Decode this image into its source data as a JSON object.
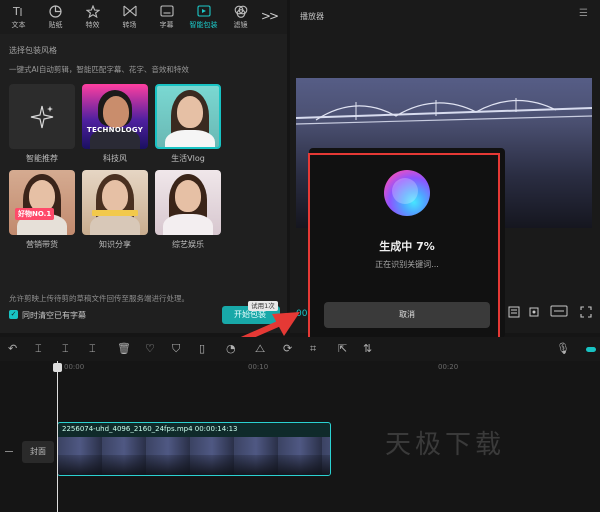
{
  "left_panel": {
    "tabs": [
      {
        "label": "文本",
        "icon": "text-icon"
      },
      {
        "label": "贴纸",
        "icon": "sticker-icon"
      },
      {
        "label": "特效",
        "icon": "effects-icon"
      },
      {
        "label": "转场",
        "icon": "transition-icon"
      },
      {
        "label": "字幕",
        "icon": "caption-icon"
      },
      {
        "label": "智能包装",
        "icon": "smart-pack-icon",
        "active": true
      },
      {
        "label": "滤镜",
        "icon": "filter-icon"
      }
    ],
    "more_label": ">>",
    "section_title": "选择包装风格",
    "section_desc": "一键式AI自动剪辑，智能匹配字幕、花字、音效和特效",
    "styles": [
      {
        "label": "智能推荐",
        "thumb_text": ""
      },
      {
        "label": "科技风",
        "thumb_text": "TECHNOLOGY"
      },
      {
        "label": "生活Vlog",
        "thumb_text": ""
      },
      {
        "label": "营销带货",
        "thumb_text": "好物NO.1"
      },
      {
        "label": "知识分享",
        "thumb_text": ""
      },
      {
        "label": "综艺娱乐",
        "thumb_text": ""
      }
    ],
    "notice": "允许剪映上传待剪的草稿文件回传至服务端进行处理。",
    "checkbox_label": "同时清空已有字幕",
    "start_button": "开始包装",
    "free_badge": "试用1次"
  },
  "player": {
    "title": "播放器",
    "time_left": "00:",
    "menu_icon": "hamburger-icon"
  },
  "dialog": {
    "status_title": "生成中 7%",
    "status_sub": "正在识别关键词...",
    "cancel_label": "取消",
    "progress_percent": 7,
    "highlight_color": "#e53935"
  },
  "timeline": {
    "ruler_labels": [
      "00:00",
      "00:10",
      "00:20"
    ],
    "cover_label": "封面",
    "clip_title": "2256074-uhd_4096_2160_24fps.mp4  00:00:14:13",
    "watermark": "天极下载"
  },
  "colors": {
    "accent": "#18c3c3",
    "background": "#151515"
  }
}
